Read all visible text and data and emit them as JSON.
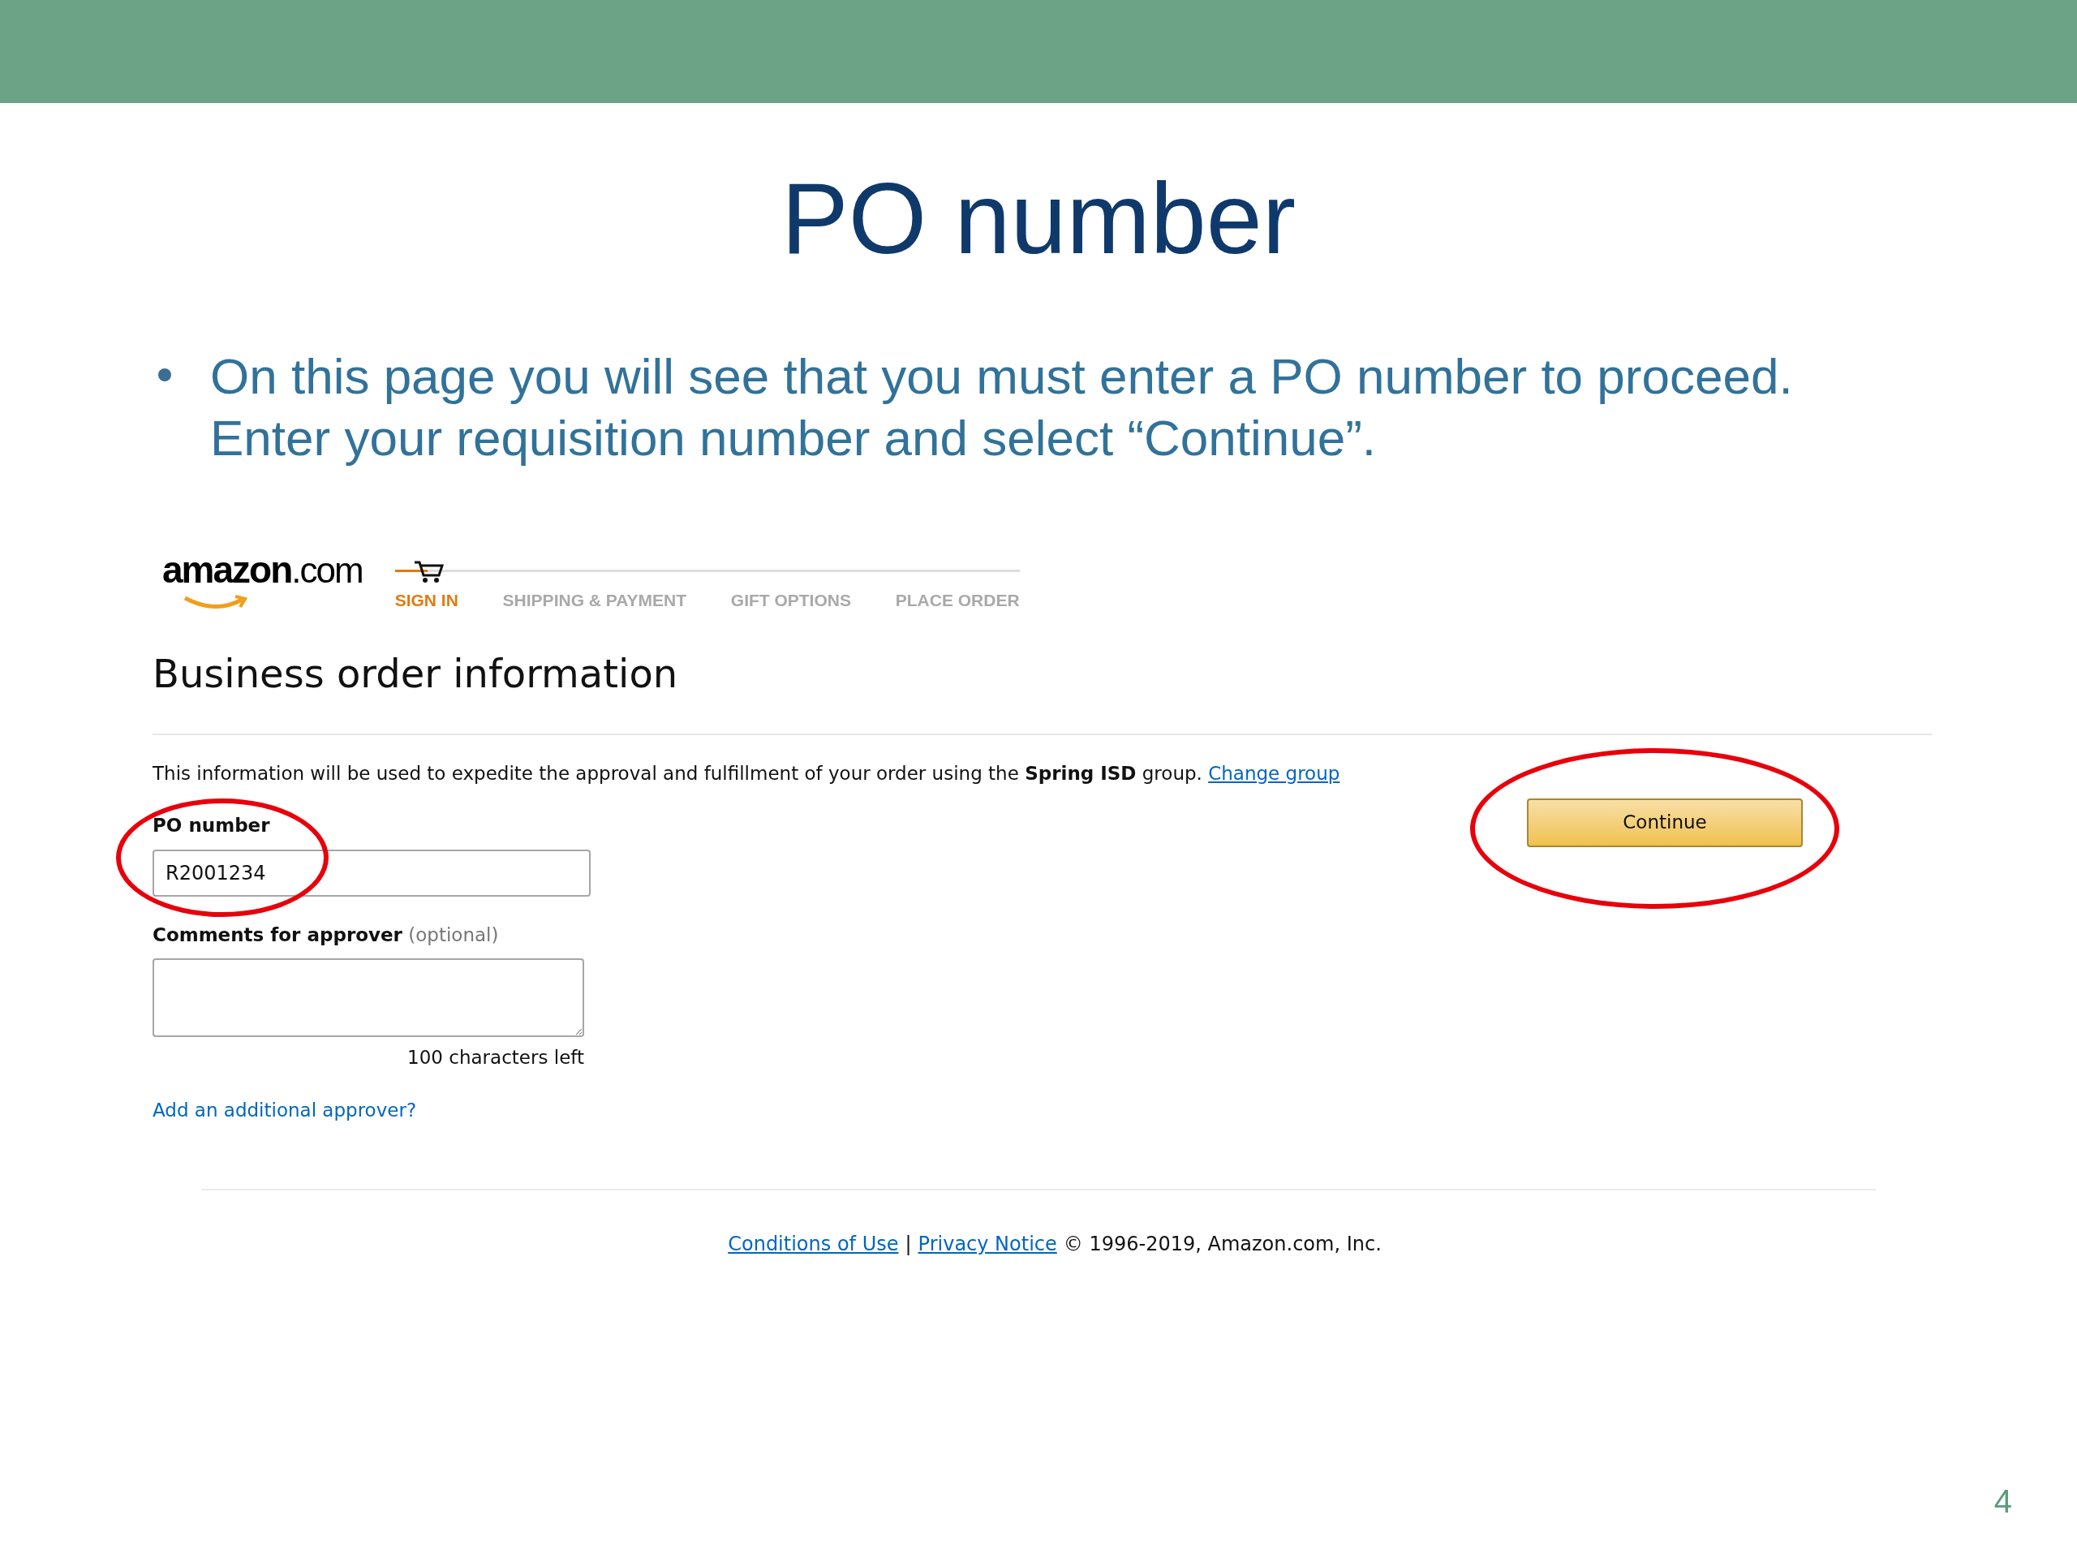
{
  "slide": {
    "title": "PO number",
    "bullets": [
      "On this page you will see that you must enter a PO number to proceed. Enter your requisition number and select “Continue”."
    ],
    "page_number": "4"
  },
  "screenshot": {
    "logo": {
      "name": "amazon",
      "suffix": ".com"
    },
    "steps": [
      {
        "label": "SIGN IN",
        "selected": true
      },
      {
        "label": "SHIPPING & PAYMENT",
        "selected": false
      },
      {
        "label": "GIFT OPTIONS",
        "selected": false
      },
      {
        "label": "PLACE ORDER",
        "selected": false
      }
    ],
    "heading": "Business order information",
    "info_text": "This information will be used to expedite the approval and fulfillment of your order using the **Spring ISD** group.",
    "change_group_link": "Change group",
    "po_field": {
      "label": "PO number",
      "value": "R2001234",
      "highlighted": true
    },
    "comments_field": {
      "label": "Comments for approver",
      "hint": "(optional)",
      "counter": "100 characters left"
    },
    "add_approver_link": "Add an additional approver?",
    "continue_button": {
      "label": "Continue",
      "highlighted": true
    },
    "footer": {
      "links": [
        "Conditions of Use",
        "Privacy Notice"
      ],
      "separator": "|",
      "copyright": "© 1996-2019, Amazon.com, Inc."
    }
  }
}
